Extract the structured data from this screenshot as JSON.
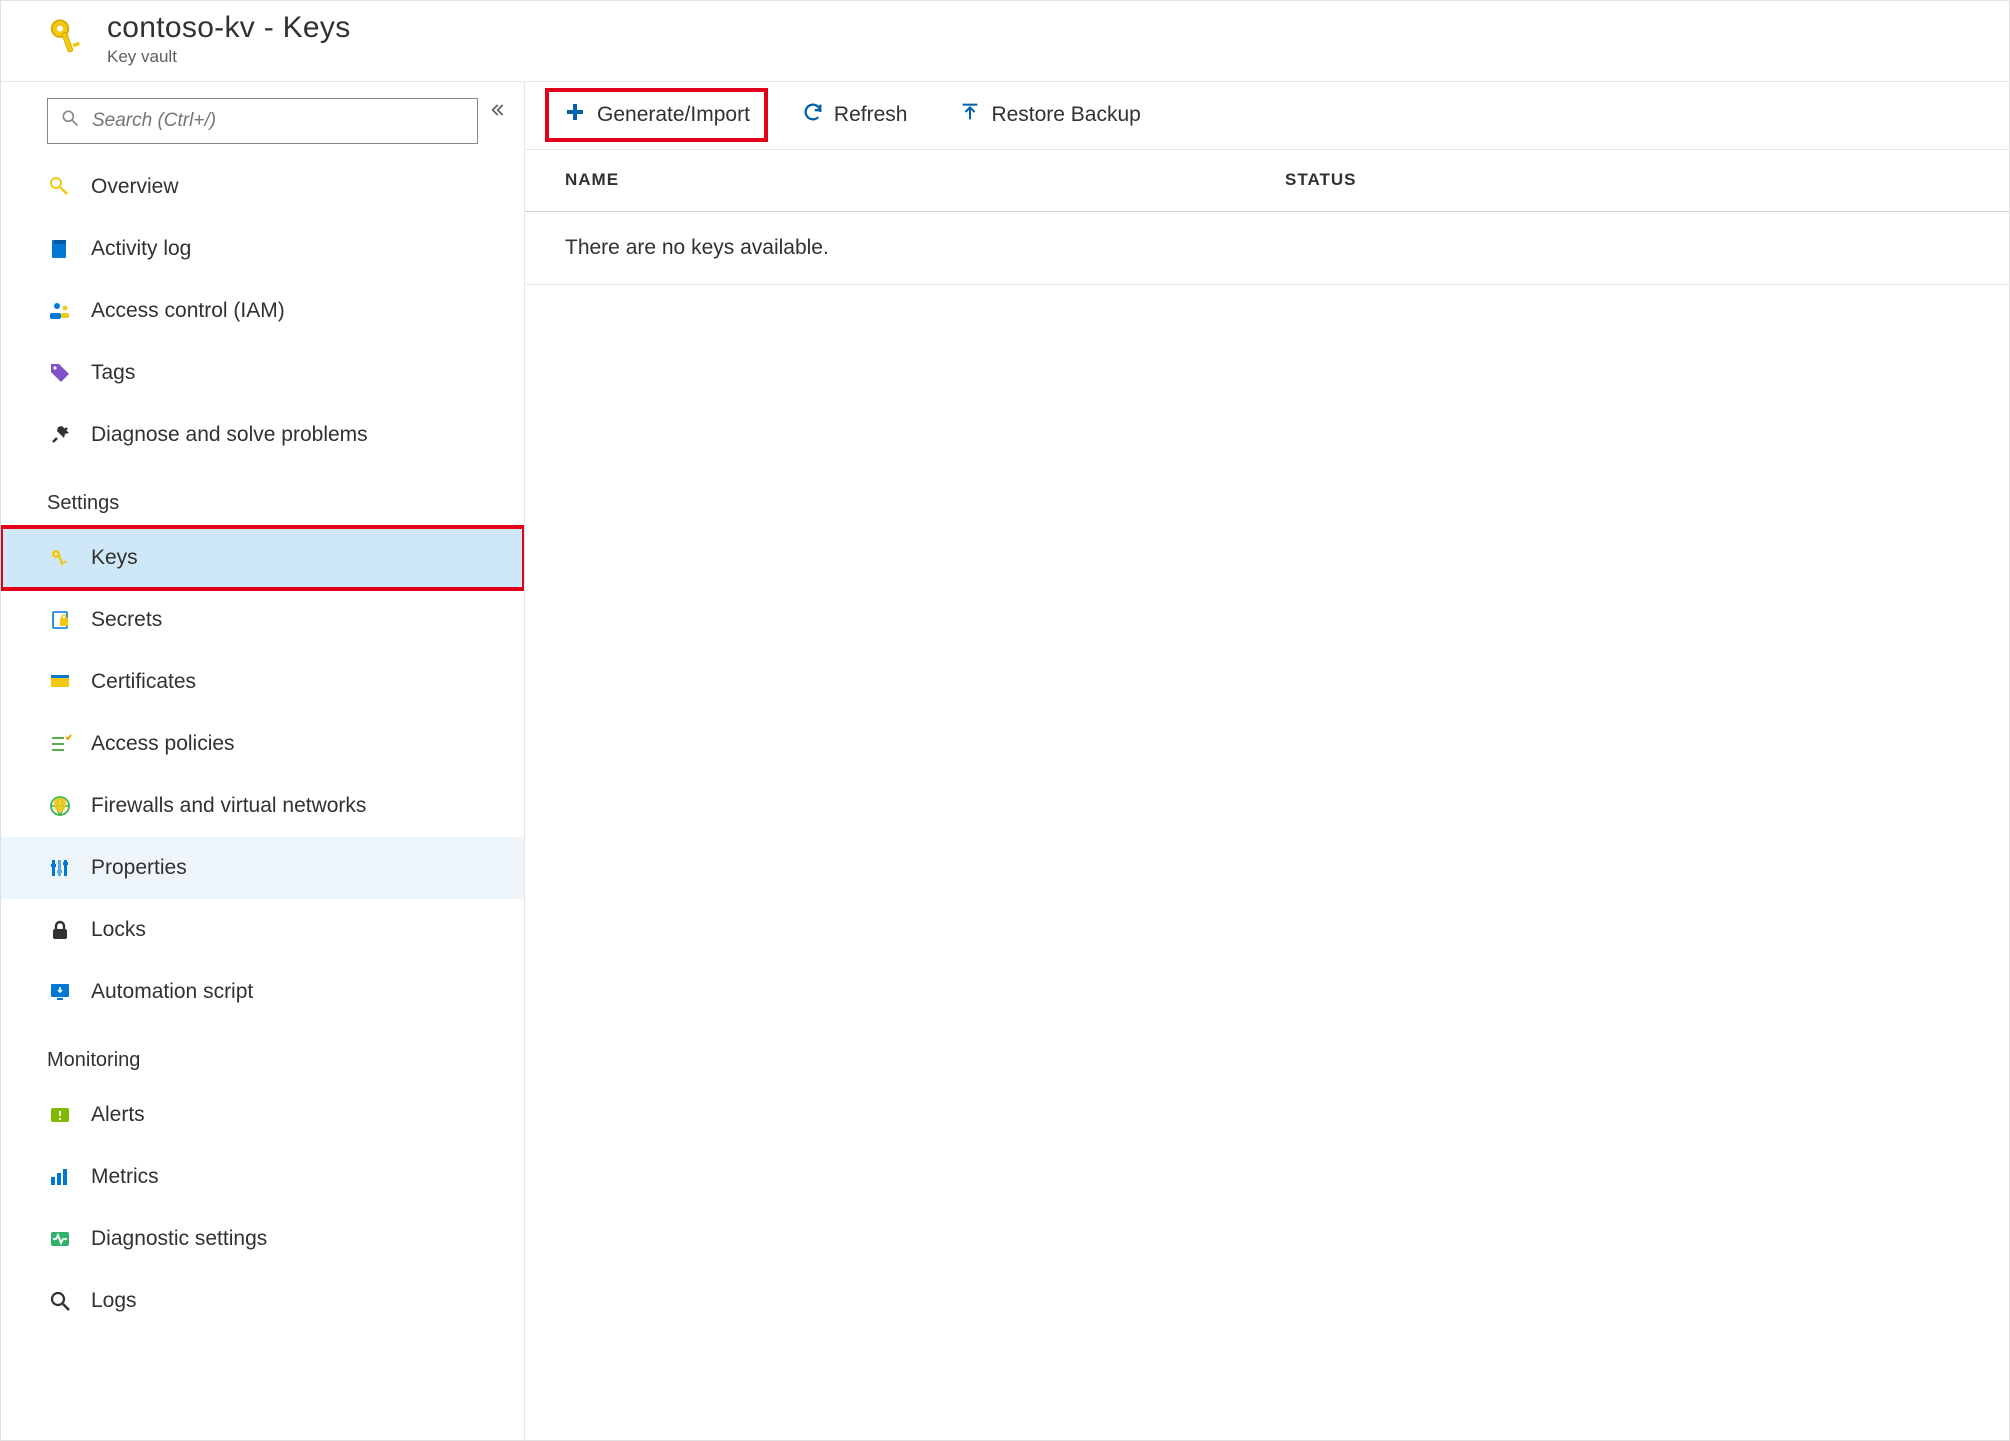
{
  "header": {
    "title": "contoso-kv - Keys",
    "subtitle": "Key vault"
  },
  "sidebar": {
    "search_placeholder": "Search (Ctrl+/)",
    "sections": [
      {
        "label": "",
        "items": [
          {
            "id": "overview",
            "label": "Overview"
          },
          {
            "id": "activity-log",
            "label": "Activity log"
          },
          {
            "id": "access-control",
            "label": "Access control (IAM)"
          },
          {
            "id": "tags",
            "label": "Tags"
          },
          {
            "id": "diagnose",
            "label": "Diagnose and solve problems"
          }
        ]
      },
      {
        "label": "Settings",
        "items": [
          {
            "id": "keys",
            "label": "Keys",
            "selected": true,
            "highlighted": true
          },
          {
            "id": "secrets",
            "label": "Secrets"
          },
          {
            "id": "certificates",
            "label": "Certificates"
          },
          {
            "id": "access-policies",
            "label": "Access policies"
          },
          {
            "id": "firewalls",
            "label": "Firewalls and virtual networks"
          },
          {
            "id": "properties",
            "label": "Properties",
            "hovered": true
          },
          {
            "id": "locks",
            "label": "Locks"
          },
          {
            "id": "automation-script",
            "label": "Automation script"
          }
        ]
      },
      {
        "label": "Monitoring",
        "items": [
          {
            "id": "alerts",
            "label": "Alerts"
          },
          {
            "id": "metrics",
            "label": "Metrics"
          },
          {
            "id": "diagnostic-settings",
            "label": "Diagnostic settings"
          },
          {
            "id": "logs",
            "label": "Logs"
          }
        ]
      }
    ]
  },
  "commandbar": {
    "generate": "Generate/Import",
    "refresh": "Refresh",
    "restore": "Restore Backup"
  },
  "table": {
    "columns": {
      "name": "NAME",
      "status": "STATUS"
    },
    "empty_message": "There are no keys available."
  },
  "colors": {
    "highlight": "#e3001b",
    "accent": "#0062ad"
  }
}
